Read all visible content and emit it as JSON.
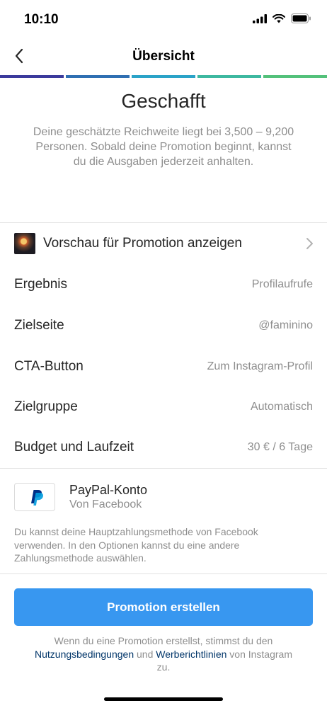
{
  "status_bar": {
    "time": "10:10",
    "icons": [
      "signal-icon",
      "wifi-icon",
      "battery-icon"
    ]
  },
  "navbar": {
    "back_icon": "chevron-left-icon",
    "title": "Übersicht"
  },
  "progress_colors": [
    "#3b3a9c",
    "#2f6fb2",
    "#2aa3c8",
    "#3db8a0",
    "#53c17a"
  ],
  "header": {
    "headline": "Geschafft",
    "description": "Deine geschätzte Reichweite liegt bei 3,500 – 9,200 Personen. Sobald deine Promotion beginnt, kannst du die Ausgaben jederzeit anhalten."
  },
  "preview": {
    "label": "Vorschau für Promotion anzeigen",
    "chevron_icon": "chevron-right-icon"
  },
  "summary": {
    "rows": [
      {
        "label": "Ergebnis",
        "value": "Profilaufrufe"
      },
      {
        "label": "Zielseite",
        "value": "@faminino"
      },
      {
        "label": "CTA-Button",
        "value": "Zum Instagram-Profil"
      },
      {
        "label": "Zielgruppe",
        "value": "Automatisch"
      },
      {
        "label": "Budget und Laufzeit",
        "value": "30 € / 6 Tage"
      }
    ]
  },
  "payment": {
    "logo_icon": "paypal-icon",
    "title": "PayPal-Konto",
    "subtitle": "Von Facebook",
    "note": "Du kannst deine Hauptzahlungsmethode von Facebook verwenden. In den Optionen kannst du eine andere Zahlungsmethode auswählen."
  },
  "cta": {
    "label": "Promotion erstellen"
  },
  "legal": {
    "before": "Wenn du eine Promotion erstellst, stimmst du den",
    "link1": "Nutzungsbedingungen",
    "middle": "und",
    "link2": "Werberichtlinien",
    "after": "von Instagram zu."
  },
  "colors": {
    "accent": "#3897f0",
    "link": "#003569",
    "secondary_text": "#8e8e8e"
  }
}
